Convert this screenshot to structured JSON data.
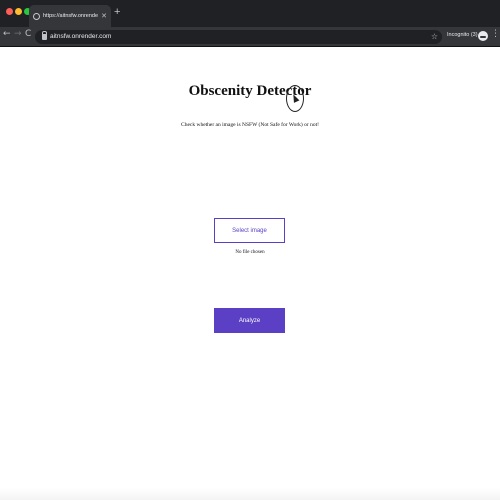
{
  "browser": {
    "tab": {
      "title": "https://aitnsfw.onrender.com",
      "close_glyph": "✕",
      "favicon": "globe-icon"
    },
    "new_tab_glyph": "+",
    "nav": {
      "back_glyph": "←",
      "forward_glyph": "→",
      "reload_glyph": "C"
    },
    "address_bar": {
      "url": "aitnsfw.onrender.com",
      "star_glyph": "☆"
    },
    "incognito_label": "Incognito (3)",
    "menu_glyph": "⋮",
    "colors": {
      "tabbar": "#202124",
      "toolbar": "#35363a"
    }
  },
  "page": {
    "title": "Obscenity Detector",
    "subtitle": "Check whether an image is NSFW (Not Safe for Work) or not!",
    "select_button_label": "Select image",
    "file_status": "No file chosen",
    "analyze_button_label": "Analyze",
    "colors": {
      "accent": "#5b3fc4"
    }
  }
}
